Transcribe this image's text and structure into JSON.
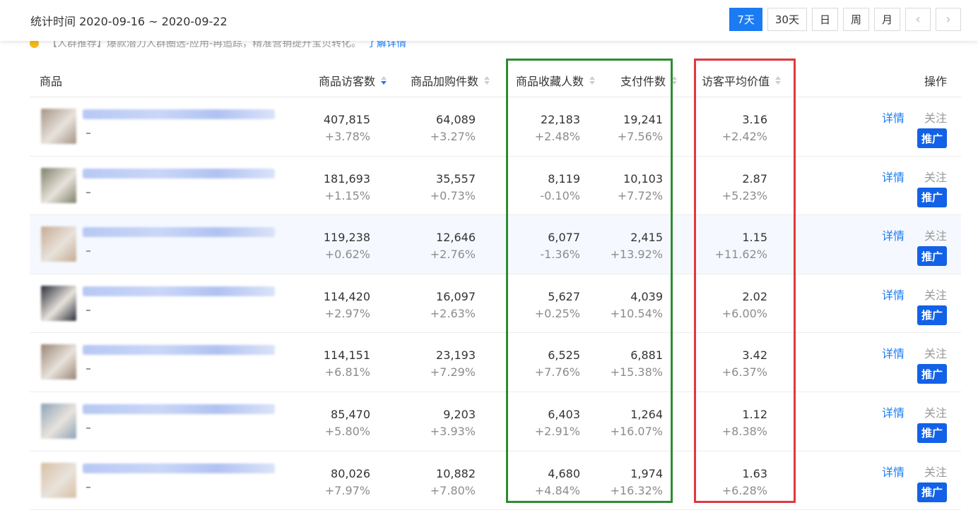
{
  "header": {
    "date_range": "统计时间 2020-09-16 ~ 2020-09-22",
    "buttons": [
      "7天",
      "30天",
      "日",
      "周",
      "月"
    ],
    "active_button": "7天",
    "prev_icon": "chevron-left-icon",
    "next_icon": "chevron-right-icon"
  },
  "notice": {
    "text": "【人群推荐】爆款潜力人群圈选-应用-再追踪，精准营销提升宝贝转化。",
    "link": "了解详情"
  },
  "table": {
    "columns": {
      "product": "商品",
      "visitors": "商品访客数",
      "cart": "商品加购件数",
      "favorites": "商品收藏人数",
      "paid": "支付件数",
      "avg_value": "访客平均价值",
      "actions": "操作"
    },
    "sorted_column": "visitors",
    "rows": [
      {
        "visitors": "407,815",
        "visitors_chg": "+3.78%",
        "cart": "64,089",
        "cart_chg": "+3.27%",
        "fav": "22,183",
        "fav_chg": "+2.48%",
        "paid": "19,241",
        "paid_chg": "+7.56%",
        "avg": "3.16",
        "avg_chg": "+2.42%",
        "thumb_color": "#a69486"
      },
      {
        "visitors": "181,693",
        "visitors_chg": "+1.15%",
        "cart": "35,557",
        "cart_chg": "+0.73%",
        "fav": "8,119",
        "fav_chg": "-0.10%",
        "paid": "10,103",
        "paid_chg": "+7.72%",
        "avg": "2.87",
        "avg_chg": "+5.23%",
        "thumb_color": "#7f8069"
      },
      {
        "visitors": "119,238",
        "visitors_chg": "+0.62%",
        "cart": "12,646",
        "cart_chg": "+2.76%",
        "fav": "6,077",
        "fav_chg": "-1.36%",
        "paid": "2,415",
        "paid_chg": "+13.92%",
        "avg": "1.15",
        "avg_chg": "+11.62%",
        "thumb_color": "#c6aa92"
      },
      {
        "visitors": "114,420",
        "visitors_chg": "+2.97%",
        "cart": "16,097",
        "cart_chg": "+2.63%",
        "fav": "5,627",
        "fav_chg": "+0.25%",
        "paid": "4,039",
        "paid_chg": "+10.54%",
        "avg": "2.02",
        "avg_chg": "+6.00%",
        "thumb_color": "#2b2f3a"
      },
      {
        "visitors": "114,151",
        "visitors_chg": "+6.81%",
        "cart": "23,193",
        "cart_chg": "+7.29%",
        "fav": "6,525",
        "fav_chg": "+7.76%",
        "paid": "6,881",
        "paid_chg": "+15.38%",
        "avg": "3.42",
        "avg_chg": "+6.37%",
        "thumb_color": "#9a8474"
      },
      {
        "visitors": "85,470",
        "visitors_chg": "+5.80%",
        "cart": "9,203",
        "cart_chg": "+3.93%",
        "fav": "6,403",
        "fav_chg": "+2.91%",
        "paid": "1,264",
        "paid_chg": "+16.07%",
        "avg": "1.12",
        "avg_chg": "+8.38%",
        "thumb_color": "#8ea3b8"
      },
      {
        "visitors": "80,026",
        "visitors_chg": "+7.97%",
        "cart": "10,882",
        "cart_chg": "+7.80%",
        "fav": "4,680",
        "fav_chg": "+4.84%",
        "paid": "1,974",
        "paid_chg": "+16.32%",
        "avg": "1.63",
        "avg_chg": "+6.28%",
        "thumb_color": "#d8c0a4"
      }
    ],
    "action_labels": {
      "detail": "详情",
      "follow": "关注",
      "promote": "推广"
    }
  },
  "highlights": {
    "green": "#2e8b30",
    "red": "#e0383c"
  }
}
